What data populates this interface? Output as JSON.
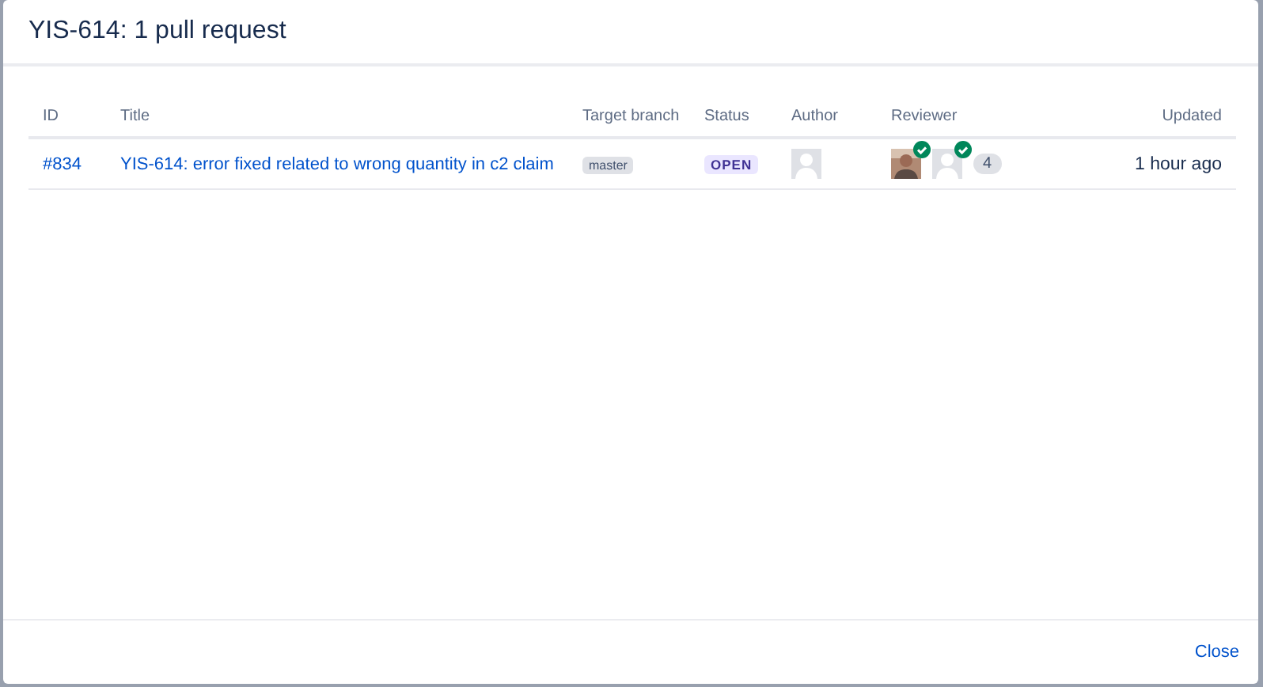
{
  "dialog": {
    "title": "YIS-614: 1 pull request",
    "close_button": "Close"
  },
  "table": {
    "columns": [
      "ID",
      "Title",
      "Target branch",
      "Status",
      "Author",
      "Reviewer",
      "Updated"
    ],
    "rows": [
      {
        "id": "#834",
        "title": "YIS-614: error fixed related to wrong quantity in c2 claim",
        "target_branch": "master",
        "status": "OPEN",
        "author": {
          "kind": "default"
        },
        "reviewers": [
          {
            "kind": "photo",
            "approved": true
          },
          {
            "kind": "default",
            "approved": true
          }
        ],
        "reviewer_count": "4",
        "updated": "1 hour ago"
      }
    ]
  }
}
